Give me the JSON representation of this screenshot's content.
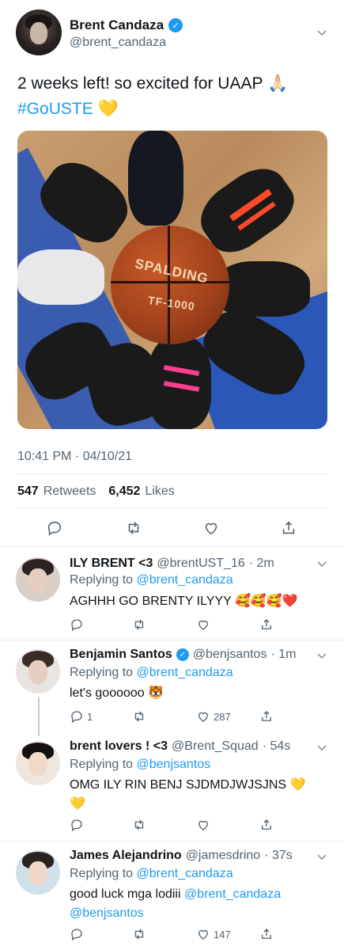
{
  "main_tweet": {
    "author_name": "Brent Candaza",
    "author_handle": "@brent_candaza",
    "text_line1": "2 weeks left! so excited for UAAP",
    "text_emoji1": "🙏🏻",
    "hashtag": "#GoUSTE",
    "text_emoji2": "💛",
    "photo_ball_brand": "SPALDING",
    "photo_ball_model": "TF-1000",
    "timestamp": "10:41 PM · 04/10/21",
    "retweets_count": "547",
    "retweets_label": "Retweets",
    "likes_count": "6,452",
    "likes_label": "Likes"
  },
  "replies": [
    {
      "name": "ILY BRENT <3",
      "handle": "@brentUST_16",
      "time": "· 2m",
      "replying_to_label": "Replying to",
      "replying_to": "@brent_candaza",
      "text": "AGHHH GO BRENTY ILYYY",
      "emojis": "🥰🥰🥰❤️",
      "reply_count": "",
      "like_count": ""
    },
    {
      "name": "Benjamin Santos",
      "handle": "@benjsantos",
      "time": "· 1m",
      "replying_to_label": "Replying to",
      "replying_to": "@brent_candaza",
      "text": "let's goooooo",
      "emojis": "🐯",
      "reply_count": "1",
      "like_count": "287"
    },
    {
      "name": "brent lovers ! <3",
      "handle": "@Brent_Squad",
      "time": "· 54s",
      "replying_to_label": "Replying to",
      "replying_to": "@benjsantos",
      "text": "OMG ILY RIN BENJ SJDMDJWJSJNS",
      "emojis": "💛",
      "emojis2": "💛",
      "reply_count": "",
      "like_count": ""
    },
    {
      "name": "James Alejandrino",
      "handle": "@jamesdrino",
      "time": "· 37s",
      "replying_to_label": "Replying to",
      "replying_to": "@brent_candaza",
      "text_prefix": "good luck mga lodiii",
      "mention1": "@brent_candaza",
      "mention2": "@benjsantos",
      "reply_count": "",
      "like_count": "147"
    }
  ],
  "colors": {
    "accent": "#1d9bf0",
    "text": "#0f1419",
    "muted": "#536471",
    "divider": "#e6ecf0"
  }
}
